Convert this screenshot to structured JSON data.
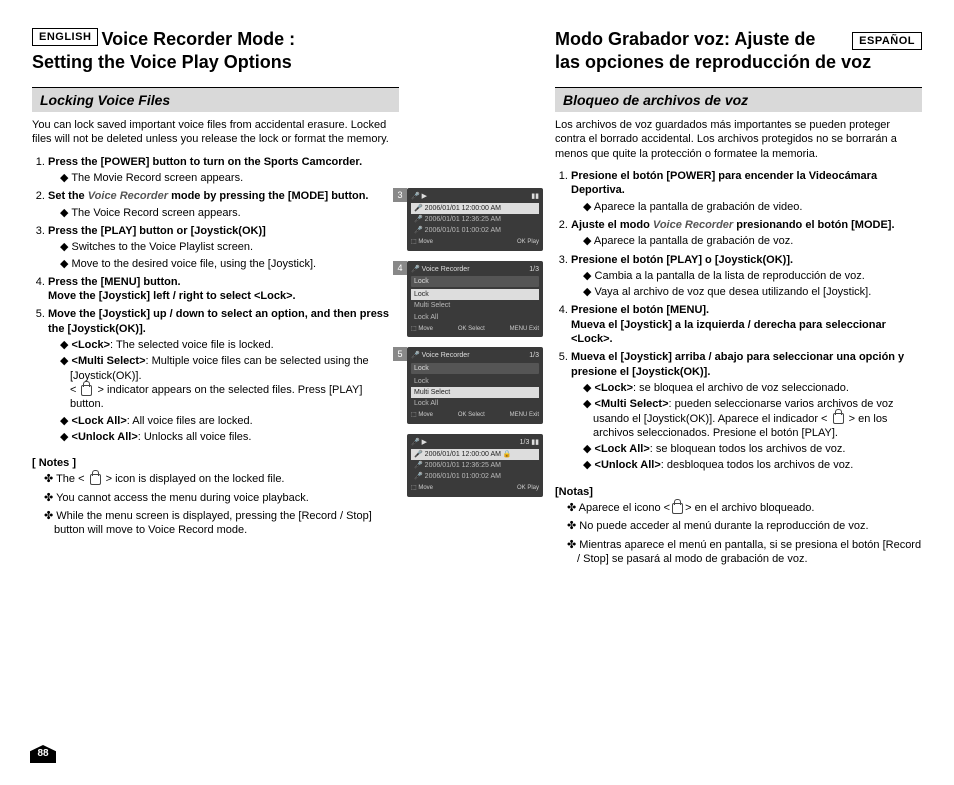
{
  "page_number": "88",
  "en": {
    "lang": "ENGLISH",
    "title1": "Voice Recorder Mode :",
    "title2": "Setting the Voice Play Options",
    "subhead": "Locking Voice Files",
    "intro": "You can lock saved important voice files from accidental erasure. Locked files will not be deleted unless you release the lock or format the memory.",
    "s1": "Press the [POWER] button to turn on the Sports Camcorder.",
    "s1a": "The Movie Record screen appears.",
    "s2a": "Set the ",
    "s2b": "Voice Recorder",
    "s2c": " mode by pressing the [MODE] button.",
    "s2d": "The Voice Record screen appears.",
    "s3": "Press the [PLAY] button or [Joystick(OK)]",
    "s3a": "Switches to the Voice Playlist screen.",
    "s3b": "Move to the desired voice file, using the [Joystick].",
    "s4": "Press the [MENU] button.",
    "s4b": "Move the [Joystick] left / right to select <Lock>.",
    "s5": "Move the [Joystick] up / down to select an option, and then press the [Joystick(OK)].",
    "s5a": "<Lock>",
    "s5a2": ": The selected voice file is locked.",
    "s5b": "<Multi Select>",
    "s5b2": ": Multiple voice files can be selected using the [Joystick(OK)].",
    "s5b3": "> indicator appears on the selected files. Press [PLAY] button.",
    "s5c": "<Lock All>",
    "s5c2": ": All voice files are locked.",
    "s5d": "<Unlock All>",
    "s5d2": ": Unlocks all voice files.",
    "notes_h": "[ Notes ]",
    "n1a": "The < ",
    "n1b": " > icon is displayed on the locked file.",
    "n2": "You cannot access the menu during voice playback.",
    "n3": "While the menu screen is displayed, pressing the [Record / Stop] button will move to Voice  Record mode."
  },
  "es": {
    "lang": "ESPAÑOL",
    "title1": "Modo Grabador voz: Ajuste de",
    "title2": "las opciones de reproducción de voz",
    "subhead": "Bloqueo de archivos de voz",
    "intro": "Los archivos de voz guardados más importantes se pueden proteger contra el borrado accidental. Los archivos protegidos no se borrarán a menos que quite la protección o formatee la memoria.",
    "s1": "Presione el botón [POWER] para encender la Videocámara Deportiva.",
    "s1a": "Aparece la pantalla de grabación de video.",
    "s2a": "Ajuste el modo ",
    "s2b": "Voice Recorder",
    "s2c": " presionando el botón [MODE].",
    "s2d": "Aparece la pantalla de grabación de voz.",
    "s3": "Presione el botón [PLAY] o [Joystick(OK)].",
    "s3a": "Cambia a la pantalla de la lista de reproducción de voz.",
    "s3b": "Vaya al archivo de voz que desea utilizando el [Joystick].",
    "s4": "Presione el botón [MENU].",
    "s4b": "Mueva el [Joystick] a la izquierda / derecha para seleccionar <Lock>.",
    "s5": "Mueva el [Joystick] arriba / abajo para seleccionar una opción y presione el [Joystick(OK)].",
    "s5a": "<Lock>",
    "s5a2": ": se bloquea el archivo de voz seleccionado.",
    "s5b": "<Multi Select>",
    "s5b2": ": pueden seleccionarse varios archivos de voz usando el [Joystick(OK)]. Aparece el indicador < ",
    "s5b3": " > en los archivos seleccionados. Presione el botón [PLAY].",
    "s5c": "<Lock All>",
    "s5c2": ": se bloquean todos los archivos de voz.",
    "s5d": "<Unlock All>",
    "s5d2": ": desbloquea todos los archivos de voz.",
    "notes_h": "[Notas]",
    "n1a": "Aparece el icono <",
    "n1b": "> en el archivo bloqueado.",
    "n2": "No puede acceder al menú durante la reproducción de voz.",
    "n3": "Mientras aparece el menú en pantalla, si se presiona el botón [Record / Stop] se pasará al modo de grabación de voz."
  },
  "screens": {
    "s3": {
      "tag": "3",
      "r1": "2006/01/01 12:00:00 AM",
      "r2": "2006/01/01 12:36:25 AM",
      "r3": "2006/01/01 01:00:02 AM",
      "move": "Move",
      "ok": "Play"
    },
    "s4": {
      "tag": "4",
      "title": "Voice Recorder",
      "frac": "1/3",
      "cat": "Lock",
      "o1": "Lock",
      "o2": "Multi Select",
      "o3": "Lock All",
      "move": "Move",
      "sel": "Select",
      "exit": "Exit"
    },
    "s5": {
      "tag": "5",
      "title": "Voice Recorder",
      "frac": "1/3",
      "cat": "Lock",
      "o1": "Lock",
      "o2": "Multi Select",
      "o3": "Lock All",
      "move": "Move",
      "sel": "Select",
      "exit": "Exit"
    },
    "s6": {
      "frac": "1/3",
      "r1": "2006/01/01 12:00:00 AM",
      "r2": "2006/01/01 12:36:25 AM",
      "r3": "2006/01/01 01:00:02 AM",
      "move": "Move",
      "ok": "Play"
    }
  }
}
